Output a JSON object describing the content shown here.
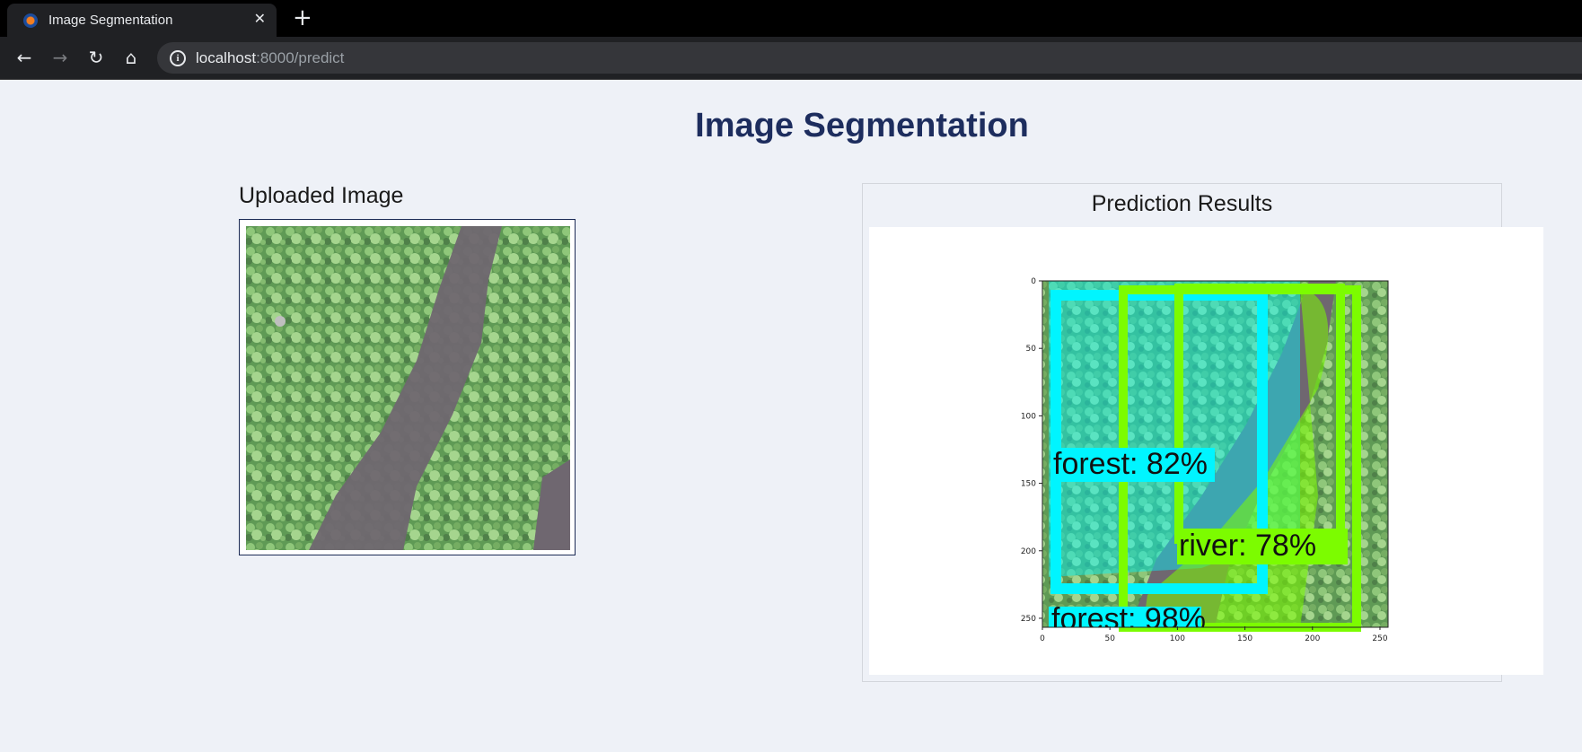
{
  "browser": {
    "tab_title": "Image Segmentation",
    "tab_close": "✕",
    "new_tab": "+",
    "url_host": "localhost",
    "url_path": ":8000/predict",
    "back": "←",
    "forward": "→",
    "reload": "↻",
    "home": "⌂",
    "info": "i"
  },
  "page": {
    "title": "Image Segmentation",
    "upload_heading": "Uploaded Image",
    "results_heading": "Prediction Results"
  },
  "plot": {
    "ticks_x": [
      "0",
      "50",
      "100",
      "150",
      "200",
      "250"
    ],
    "ticks_y": [
      "0",
      "50",
      "100",
      "150",
      "200",
      "250"
    ],
    "detections": [
      {
        "label": "forest: 82%",
        "class": "forest"
      },
      {
        "label": "river: 78%",
        "class": "river"
      },
      {
        "label": "forest: 98%",
        "class": "forest"
      }
    ],
    "colors": {
      "forest": "#00f5ff",
      "river": "#7cfc00"
    }
  }
}
